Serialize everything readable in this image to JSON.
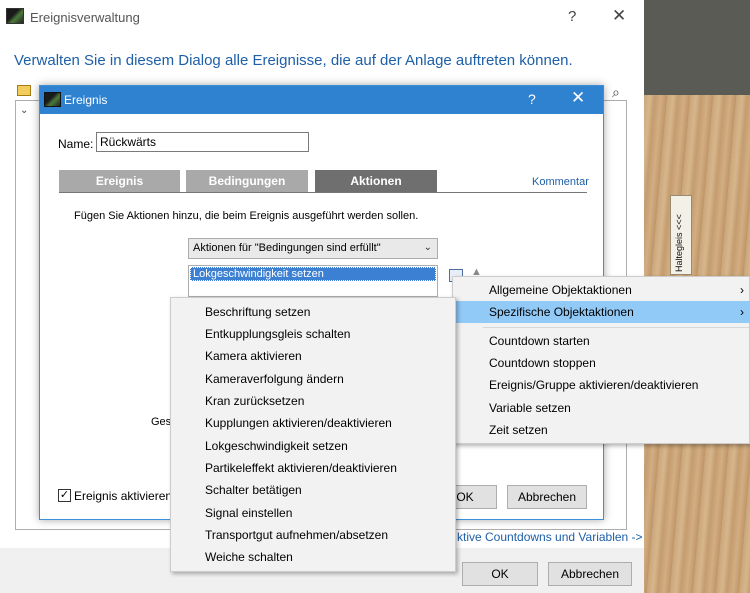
{
  "main_window": {
    "title": "Ereignisverwaltung",
    "help": "?",
    "close": "✕",
    "description": "Verwalten Sie in diesem Dialog alle Ereignisse, die auf der Anlage auftreten können.",
    "link": "ktive Countdowns und Variablen ->",
    "ok_label": "OK",
    "cancel_label": "Abbrechen"
  },
  "event_dialog": {
    "title": "Ereignis",
    "help": "?",
    "close": "✕",
    "name_label": "Name:",
    "name_value": "Rückwärts",
    "tabs": [
      {
        "label": "Ereignis"
      },
      {
        "label": "Bedingungen"
      },
      {
        "label": "Aktionen"
      }
    ],
    "active_tab": "Aktionen",
    "comment_link": "Kommentar",
    "instruction": "Fügen Sie Aktionen hinzu, die beim Ereignis ausgeführt werden sollen.",
    "dropdown_value": "Aktionen für \"Bedingungen sind erfüllt\"",
    "actions": [
      "Lokgeschwindigkeit setzen"
    ],
    "partial_label": "Ges",
    "checkbox_label": "Ereignis aktivieren",
    "checkbox_mark": "✓",
    "ok_label": "OK",
    "cancel_label": "Abbrechen"
  },
  "context_menu": {
    "items": [
      {
        "label": "Allgemeine Objektaktionen",
        "arrow": "›"
      },
      {
        "label": "Spezifische Objektaktionen",
        "arrow": "›"
      },
      {
        "label": "Countdown starten"
      },
      {
        "label": "Countdown stoppen"
      },
      {
        "label": "Ereignis/Gruppe aktivieren/deaktivieren"
      },
      {
        "label": "Variable setzen"
      },
      {
        "label": "Zeit setzen"
      }
    ],
    "highlighted": "Spezifische Objektaktionen"
  },
  "submenu": {
    "items": [
      {
        "label": "Beschriftung setzen"
      },
      {
        "label": "Entkupplungsgleis schalten"
      },
      {
        "label": "Kamera aktivieren"
      },
      {
        "label": "Kameraverfolgung ändern"
      },
      {
        "label": "Kran zurücksetzen"
      },
      {
        "label": "Kupplungen aktivieren/deaktivieren"
      },
      {
        "label": "Lokgeschwindigkeit setzen"
      },
      {
        "label": "Partikeleffekt aktivieren/deaktivieren"
      },
      {
        "label": "Schalter betätigen"
      },
      {
        "label": "Signal einstellen"
      },
      {
        "label": "Transportgut aufnehmen/absetzen"
      },
      {
        "label": "Weiche schalten"
      }
    ]
  },
  "scene": {
    "sign_text": "Haltegleis <<<"
  },
  "icons": {
    "app": "train-app-icon",
    "folder": "folder-icon",
    "search": "search-icon",
    "chevron": "chevron-down-icon"
  }
}
